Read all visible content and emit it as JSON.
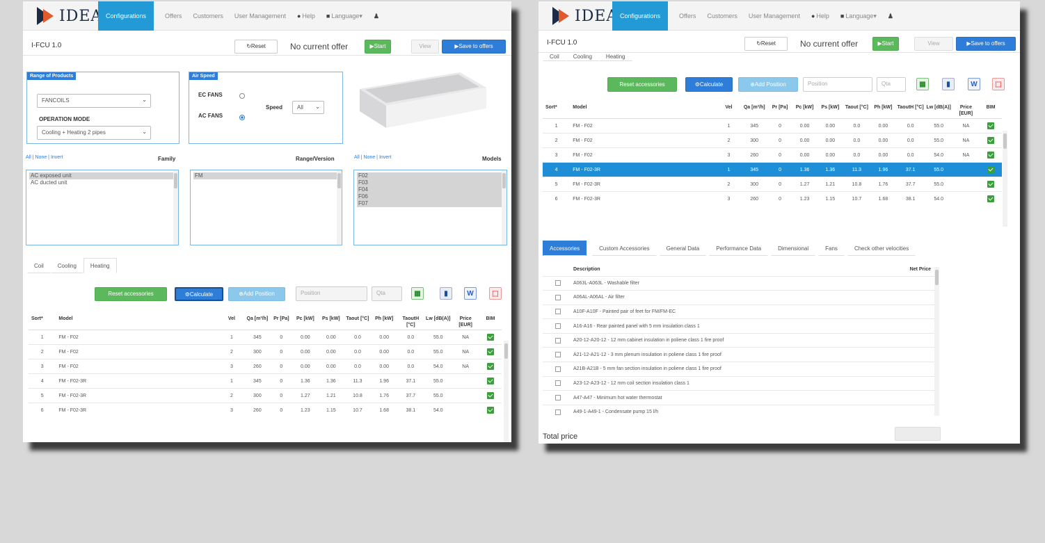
{
  "brand": "IDEA",
  "nav": {
    "configurations": "Configurations",
    "offers": "Offers",
    "customers": "Customers",
    "user_management": "User Management",
    "help": "Help",
    "language": "Language",
    "help_icon": "question-circle-icon",
    "language_icon": "flag-icon",
    "user_icon": "user-icon"
  },
  "toolbar": {
    "title": "I-FCU 1.0",
    "reset": "Reset",
    "no_offer": "No current offer",
    "start": "Start",
    "view": "View",
    "save": "Save to offers"
  },
  "range": {
    "label": "Range of Products",
    "product": "FANCOILS",
    "mode_label": "OPERATION MODE",
    "mode": "Cooling + Heating 2 pipes"
  },
  "air_speed": {
    "label": "Air Speed",
    "ec_fans": "EC FANS",
    "ac_fans": "AC FANS",
    "speed_label": "Speed",
    "speed_value": "All"
  },
  "filters": {
    "all": "All",
    "none": "None",
    "invert": "Invert",
    "family_label": "Family",
    "range_version_label": "Range/Version",
    "models_label": "Models",
    "family_options": [
      "AC exposed unit",
      "AC ducted unit"
    ],
    "range_options": [
      "FM"
    ],
    "model_options": [
      "F02",
      "F03",
      "F04",
      "F06",
      "F07"
    ]
  },
  "tabs": {
    "coil": "Coil",
    "cooling": "Cooling",
    "heating": "Heating"
  },
  "actions": {
    "reset_acc": "Reset accessories",
    "calculate": "Calculate",
    "add_position": "Add Position",
    "position_placeholder": "Position",
    "qty_placeholder": "Qta"
  },
  "results": {
    "headers": {
      "sort": "Sort*",
      "model": "Model",
      "vel": "Vel",
      "qa": "Qa [m³/h]",
      "pr": "Pr [Pa]",
      "pc": "Pc [kW]",
      "ps": "Ps [kW]",
      "taout": "Taout [°C]",
      "ph": "Ph [kW]",
      "taouth": "TaoutH [°C]",
      "lw": "Lw [dB(A)]",
      "price": "Price [EUR]",
      "bim": "BIM"
    },
    "rows": [
      {
        "sort": "1",
        "model": "FM - F02",
        "vel": "1",
        "qa": "345",
        "pr": "0",
        "pc": "0.00",
        "ps": "0.00",
        "taout": "0.0",
        "ph": "0.00",
        "taouth": "0.0",
        "lw": "55.0",
        "price": "NA"
      },
      {
        "sort": "2",
        "model": "FM - F02",
        "vel": "2",
        "qa": "300",
        "pr": "0",
        "pc": "0.00",
        "ps": "0.00",
        "taout": "0.0",
        "ph": "0.00",
        "taouth": "0.0",
        "lw": "55.0",
        "price": "NA"
      },
      {
        "sort": "3",
        "model": "FM - F02",
        "vel": "3",
        "qa": "260",
        "pr": "0",
        "pc": "0.00",
        "ps": "0.00",
        "taout": "0.0",
        "ph": "0.00",
        "taouth": "0.0",
        "lw": "54.0",
        "price": "NA"
      },
      {
        "sort": "4",
        "model": "FM - F02-3R",
        "vel": "1",
        "qa": "345",
        "pr": "0",
        "pc": "1.36",
        "ps": "1.36",
        "taout": "11.3",
        "ph": "1.96",
        "taouth": "37.1",
        "lw": "55.0",
        "price": ""
      },
      {
        "sort": "5",
        "model": "FM - F02-3R",
        "vel": "2",
        "qa": "300",
        "pr": "0",
        "pc": "1.27",
        "ps": "1.21",
        "taout": "10.8",
        "ph": "1.76",
        "taouth": "37.7",
        "lw": "55.0",
        "price": ""
      },
      {
        "sort": "6",
        "model": "FM - F02-3R",
        "vel": "3",
        "qa": "260",
        "pr": "0",
        "pc": "1.23",
        "ps": "1.15",
        "taout": "10.7",
        "ph": "1.68",
        "taouth": "38.1",
        "lw": "54.0",
        "price": ""
      }
    ]
  },
  "detail_tabs": [
    "Accessories",
    "Custom Accessories",
    "General Data",
    "Performance Data",
    "Dimensional",
    "Fans",
    "Check other velocities"
  ],
  "accessories": {
    "description_header": "Description",
    "net_price_header": "Net Price",
    "items": [
      "A063L-A063L - Washable filter",
      "A06AL-A06AL - Air filter",
      "A10F-A10F - Painted pair of feet for FM/FM-EC",
      "A16-A16 - Rear painted panel with 5 mm insulation class 1",
      "A20-12-A20-12 - 12 mm cabinet insulation in poliene class 1 fire proof",
      "A21-12-A21-12 - 3 mm plenum insulation in poliene class 1 fire proof",
      "A21B-A21B - 5 mm fan section insulation in poliene class 1 fire proof",
      "A23-12-A23-12 - 12 mm coil section insulation class 1",
      "A47-A47 - Minimum hot water thermostat",
      "A49-1-A49-1 - Condensate pump 15 l/h"
    ]
  },
  "total_price_label": "Total price"
}
